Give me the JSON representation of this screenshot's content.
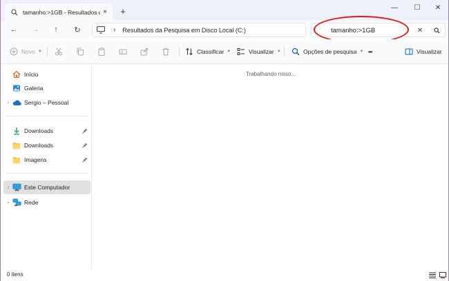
{
  "tab": {
    "title": "tamanho:>1GB - Resultados da Pesquisa em Disco Local (C:)",
    "close_glyph": "×",
    "icon": "search-icon"
  },
  "new_tab_glyph": "+",
  "window_controls": {
    "minimize": "—",
    "maximize": "☐",
    "close": "✕"
  },
  "nav": {
    "back": "←",
    "forward": "→",
    "up": "↑",
    "refresh": "↻"
  },
  "address": {
    "crumb_sep": "›",
    "location": "Resultados da Pesquisa em Disco Local (C:)"
  },
  "search": {
    "value": "tamanho:>1GB",
    "clear_glyph": "✕"
  },
  "commands": {
    "new": "Novo",
    "sort": "Classificar",
    "view": "Visualizar",
    "search_options": "Opções de pesquisa",
    "more": "•••",
    "preview": "Visualizar"
  },
  "sidebar": {
    "items": [
      {
        "label": "Início",
        "icon": "home-icon"
      },
      {
        "label": "Galeria",
        "icon": "gallery-icon"
      },
      {
        "label": "Sergio – Pessoal",
        "icon": "onedrive-icon"
      },
      {
        "label": "Downloads",
        "icon": "download-icon"
      },
      {
        "label": "Downloads",
        "icon": "folder-icon"
      },
      {
        "label": "Imagens",
        "icon": "folder-icon"
      },
      {
        "label": "Este Computador",
        "icon": "computer-icon"
      },
      {
        "label": "Rede",
        "icon": "network-icon"
      }
    ],
    "chevron": "›"
  },
  "content": {
    "status": "Trabalhando nisso..."
  },
  "statusbar": {
    "count": "0 itens"
  },
  "colors": {
    "accent": "#0067c0",
    "highlight": "#e01616",
    "folder": "#f5c342"
  }
}
